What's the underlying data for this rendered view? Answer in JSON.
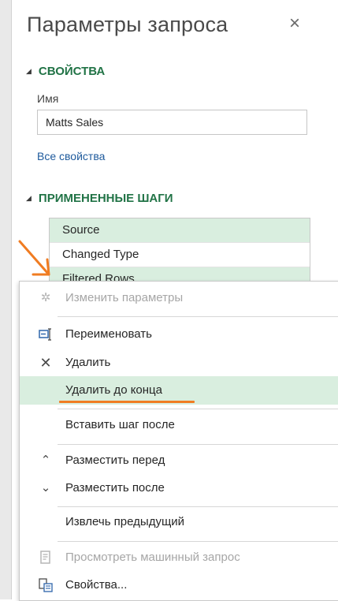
{
  "pane": {
    "title": "Параметры запроса",
    "close_glyph": "×"
  },
  "properties": {
    "heading": "СВОЙСТВА",
    "name_label": "Имя",
    "name_value": "Matts Sales",
    "all_properties_link": "Все свойства"
  },
  "applied_steps": {
    "heading": "ПРИМЕНЕННЫЕ ШАГИ",
    "items": [
      {
        "label": "Source",
        "selected": true
      },
      {
        "label": "Changed Type",
        "selected": false
      },
      {
        "label": "Filtered Rows",
        "selected": true
      }
    ]
  },
  "context_menu": {
    "items": [
      {
        "label": "Изменить параметры",
        "icon": "gear-icon",
        "disabled": true
      },
      {
        "label": "Переименовать",
        "icon": "rename-icon",
        "disabled": false
      },
      {
        "label": "Удалить",
        "icon": "delete-x-icon",
        "disabled": false
      },
      {
        "label": "Удалить до конца",
        "icon": "",
        "disabled": false,
        "highlighted": true
      },
      {
        "label": "Вставить шаг после",
        "icon": "",
        "disabled": false
      },
      {
        "label": "Разместить перед",
        "icon": "chevron-up-icon",
        "disabled": false
      },
      {
        "label": "Разместить после",
        "icon": "chevron-down-icon",
        "disabled": false
      },
      {
        "label": "Извлечь предыдущий",
        "icon": "",
        "disabled": false
      },
      {
        "label": "Просмотреть машинный запрос",
        "icon": "native-query-icon",
        "disabled": true
      },
      {
        "label": "Свойства...",
        "icon": "properties-icon",
        "disabled": false
      }
    ]
  },
  "colors": {
    "accent_green": "#217346",
    "selection_bg": "#d9eedf",
    "annotation_orange": "#f07c22",
    "link_blue": "#1e5a9c"
  }
}
